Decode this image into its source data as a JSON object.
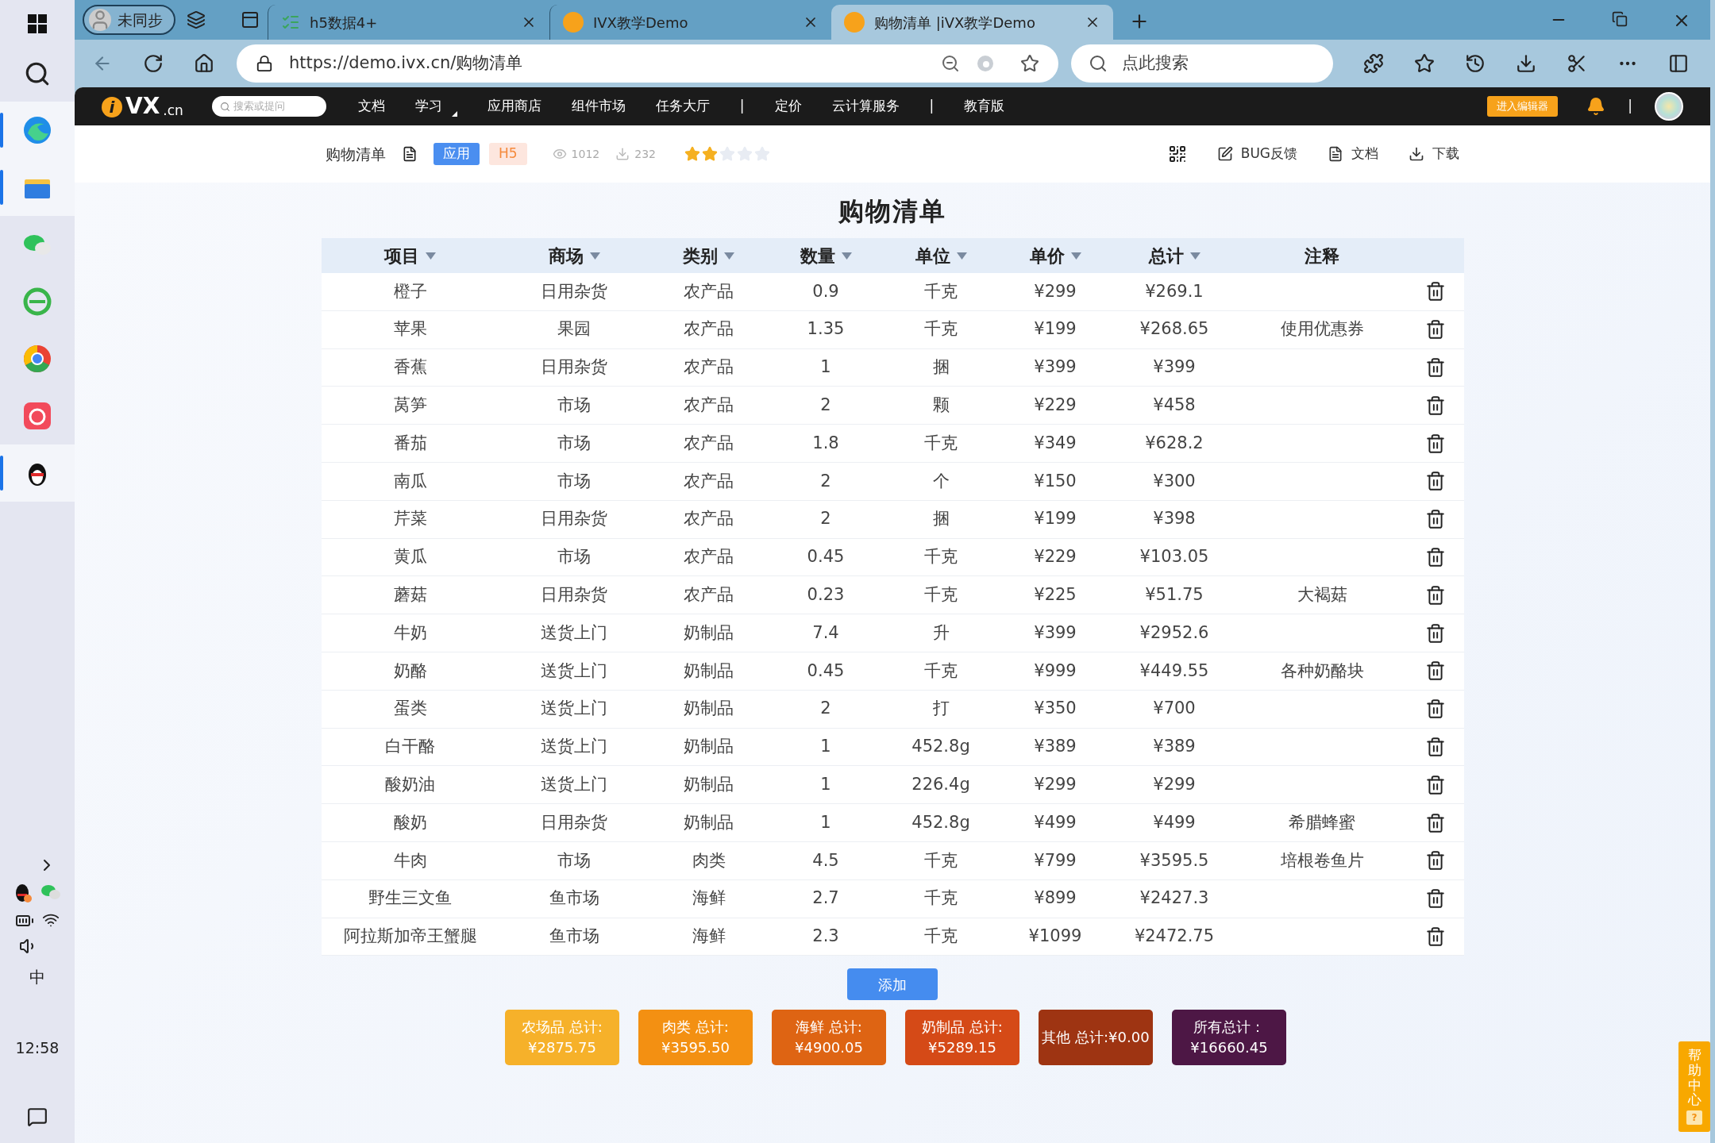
{
  "taskbar": {
    "time": "12:58",
    "ime": "中"
  },
  "browser": {
    "profile": "未同步",
    "tabs": [
      {
        "title": "h5数据4+",
        "kind": "sheet",
        "selected": false
      },
      {
        "title": "IVX教学Demo",
        "kind": "ivx",
        "selected": false
      },
      {
        "title": "购物清单 |iVX教学Demo",
        "kind": "ivx",
        "selected": true
      }
    ],
    "url": "https://demo.ivx.cn/购物清单",
    "search": {
      "placeholder": "点此搜索"
    }
  },
  "site_nav": {
    "logo": {
      "mark": "i",
      "name": "VX",
      "suffix": ".cn"
    },
    "search": {
      "placeholder": "搜索或提问"
    },
    "items": [
      {
        "label": "文档",
        "kind": "link"
      },
      {
        "label": "学习",
        "kind": "dropdown"
      },
      {
        "label": "应用商店",
        "kind": "link"
      },
      {
        "label": "组件市场",
        "kind": "link"
      },
      {
        "label": "任务大厅",
        "kind": "link"
      },
      {
        "label": "|",
        "kind": "separator"
      },
      {
        "label": "定价",
        "kind": "link"
      },
      {
        "label": "云计算服务",
        "kind": "link"
      },
      {
        "label": "|",
        "kind": "separator"
      },
      {
        "label": "教育版",
        "kind": "link"
      }
    ],
    "editor_button": "进入编辑器",
    "separator": "|"
  },
  "app_header": {
    "title": "购物清单",
    "tags": [
      {
        "label": "应用",
        "kind": "primary"
      },
      {
        "label": "H5",
        "kind": "soft"
      }
    ],
    "views": "1012",
    "downloads": "232",
    "stars": 2,
    "actions": [
      {
        "label": "BUG反馈",
        "kind": "edit"
      },
      {
        "label": "文档",
        "kind": "doc"
      },
      {
        "label": "下载",
        "kind": "download"
      }
    ]
  },
  "page": {
    "title": "购物清单",
    "table": {
      "columns": [
        {
          "label": "项目",
          "sortable": true
        },
        {
          "label": "商场",
          "sortable": true
        },
        {
          "label": "类别",
          "sortable": true
        },
        {
          "label": "数量",
          "sortable": true
        },
        {
          "label": "单位",
          "sortable": true
        },
        {
          "label": "单价",
          "sortable": true
        },
        {
          "label": "总计",
          "sortable": true
        },
        {
          "label": "注释",
          "sortable": false
        }
      ],
      "rows": [
        [
          "橙子",
          "日用杂货",
          "农产品",
          "0.9",
          "千克",
          "¥299",
          "¥269.1",
          ""
        ],
        [
          "苹果",
          "果园",
          "农产品",
          "1.35",
          "千克",
          "¥199",
          "¥268.65",
          "使用优惠券"
        ],
        [
          "香蕉",
          "日用杂货",
          "农产品",
          "1",
          "捆",
          "¥399",
          "¥399",
          ""
        ],
        [
          "莴笋",
          "市场",
          "农产品",
          "2",
          "颗",
          "¥229",
          "¥458",
          ""
        ],
        [
          "番茄",
          "市场",
          "农产品",
          "1.8",
          "千克",
          "¥349",
          "¥628.2",
          ""
        ],
        [
          "南瓜",
          "市场",
          "农产品",
          "2",
          "个",
          "¥150",
          "¥300",
          ""
        ],
        [
          "芹菜",
          "日用杂货",
          "农产品",
          "2",
          "捆",
          "¥199",
          "¥398",
          ""
        ],
        [
          "黄瓜",
          "市场",
          "农产品",
          "0.45",
          "千克",
          "¥229",
          "¥103.05",
          ""
        ],
        [
          "蘑菇",
          "日用杂货",
          "农产品",
          "0.23",
          "千克",
          "¥225",
          "¥51.75",
          "大褐菇"
        ],
        [
          "牛奶",
          "送货上门",
          "奶制品",
          "7.4",
          "升",
          "¥399",
          "¥2952.6",
          ""
        ],
        [
          "奶酪",
          "送货上门",
          "奶制品",
          "0.45",
          "千克",
          "¥999",
          "¥449.55",
          "各种奶酪块"
        ],
        [
          "蛋类",
          "送货上门",
          "奶制品",
          "2",
          "打",
          "¥350",
          "¥700",
          ""
        ],
        [
          "白干酪",
          "送货上门",
          "奶制品",
          "1",
          "452.8g",
          "¥389",
          "¥389",
          ""
        ],
        [
          "酸奶油",
          "送货上门",
          "奶制品",
          "1",
          "226.4g",
          "¥299",
          "¥299",
          ""
        ],
        [
          "酸奶",
          "日用杂货",
          "奶制品",
          "1",
          "452.8g",
          "¥499",
          "¥499",
          "希腊蜂蜜"
        ],
        [
          "牛肉",
          "市场",
          "肉类",
          "4.5",
          "千克",
          "¥799",
          "¥3595.5",
          "培根卷鱼片"
        ],
        [
          "野生三文鱼",
          "鱼市场",
          "海鲜",
          "2.7",
          "千克",
          "¥899",
          "¥2427.3",
          ""
        ],
        [
          "阿拉斯加帝王蟹腿",
          "鱼市场",
          "海鲜",
          "2.3",
          "千克",
          "¥1099",
          "¥2472.75",
          ""
        ]
      ]
    },
    "add_button": "添加",
    "totals": [
      {
        "lines": [
          "农场品 总计:",
          "¥2875.75"
        ],
        "color": "#f6b12a"
      },
      {
        "lines": [
          "肉类 总计:",
          "¥3595.50"
        ],
        "color": "#f39012"
      },
      {
        "lines": [
          "海鲜 总计:",
          "¥4900.05"
        ],
        "color": "#de6413"
      },
      {
        "lines": [
          "奶制品 总计:",
          "¥5289.15"
        ],
        "color": "#d54a17"
      },
      {
        "lines": [
          "其他 总计:¥0.00"
        ],
        "color": "#9e3412"
      },
      {
        "lines": [
          "所有总计：",
          "¥16660.45"
        ],
        "color": "#4d1745"
      }
    ]
  },
  "help_center": {
    "label": "帮助中心",
    "icon_text": "?"
  }
}
